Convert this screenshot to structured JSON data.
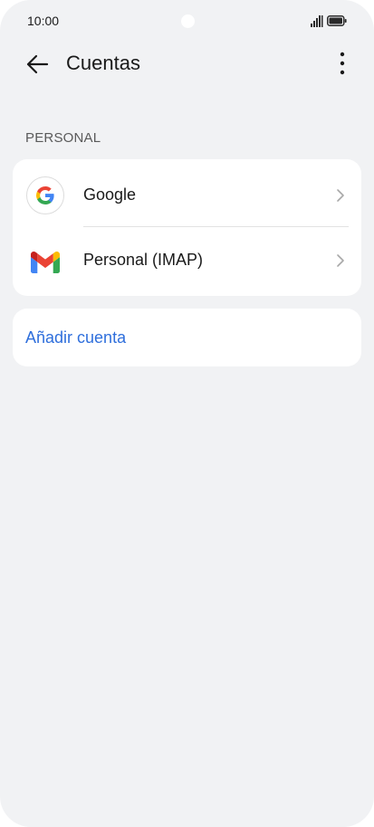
{
  "status_bar": {
    "time": "10:00",
    "icons": [
      "signal-icon",
      "battery-icon"
    ]
  },
  "header": {
    "title": "Cuentas",
    "back_icon": "back-arrow-icon",
    "menu_icon": "more-vertical-icon"
  },
  "section": {
    "label": "PERSONAL"
  },
  "accounts": [
    {
      "label": "Google",
      "icon": "google-icon"
    },
    {
      "label": "Personal (IMAP)",
      "icon": "gmail-icon"
    }
  ],
  "add_account": {
    "label": "Añadir cuenta"
  },
  "colors": {
    "background": "#f1f2f4",
    "card": "#ffffff",
    "accent": "#2f6fdc",
    "text": "#1a1a1a"
  }
}
